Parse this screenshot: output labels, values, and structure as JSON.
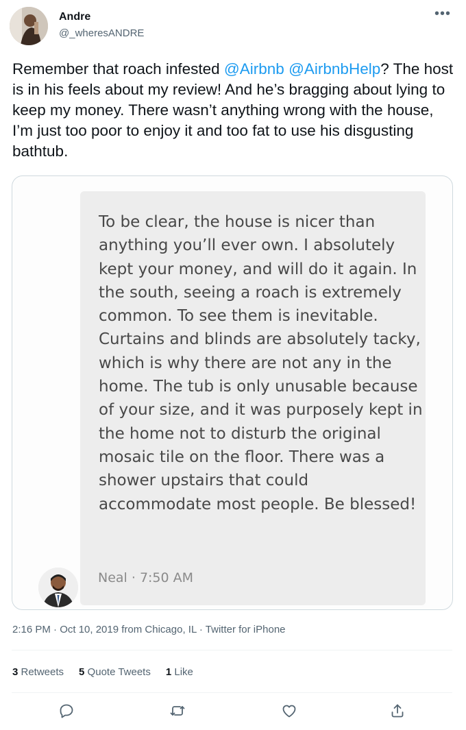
{
  "author": {
    "name": "Andre",
    "handle": "@_wheresANDRE"
  },
  "tweet": {
    "text_1": "Remember that roach infested ",
    "mention_1": "@Airbnb",
    "text_2": " ",
    "mention_2": "@AirbnbHelp",
    "text_3": "? The host is in his feels about my review! And he’s bragging about lying to keep my money. There wasn’t anything wrong with the house, I’m just too poor to enjoy it and too fat to use his disgusting bathtub."
  },
  "review": {
    "text": "To be clear, the house is nicer than anything you’ll ever own. I absolutely kept your money, and will do it again. In the south, seeing a roach is extremely common. To see them is inevitable. Curtains and blinds are absolutely tacky, which is why there are not any in the home. The tub is only unusable because of your size, and it was purposely kept in the home not to disturb the original mosaic tile on the floor. There was a shower upstairs that could accommodate most people. Be blessed!",
    "meta": "Neal · 7:50 AM"
  },
  "timestamp": "2:16 PM · Oct 10, 2019 from Chicago, IL · Twitter for iPhone",
  "stats": {
    "retweets_count": "3",
    "retweets_label": " Retweets",
    "quotes_count": "5",
    "quotes_label": " Quote Tweets",
    "likes_count": "1",
    "likes_label": " Like"
  },
  "icons": {
    "more": "more-icon",
    "reply": "reply-icon",
    "retweet": "retweet-icon",
    "like": "like-icon",
    "share": "share-icon"
  },
  "colors": {
    "mention": "#1d9bf0",
    "icon": "#536471"
  }
}
